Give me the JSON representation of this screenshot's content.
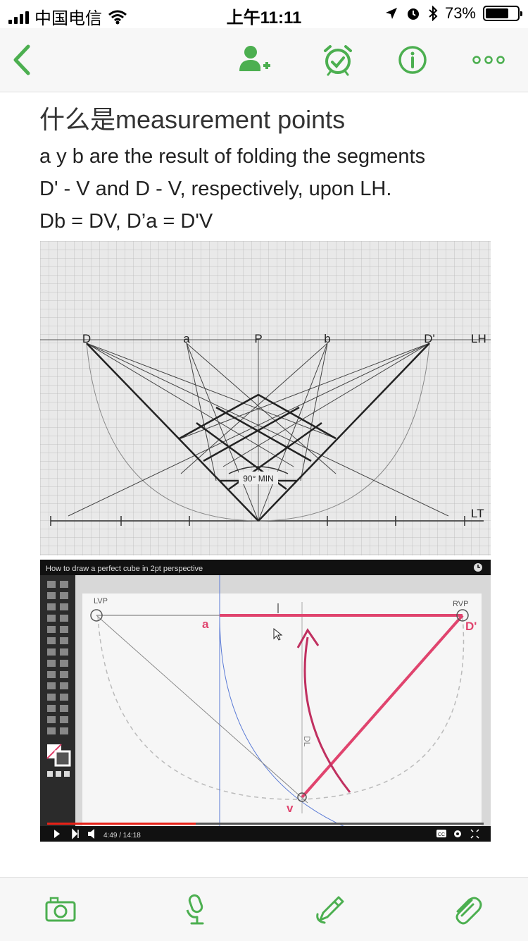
{
  "status_bar": {
    "carrier": "中国电信",
    "time": "上午11:11",
    "battery": "73%",
    "battery_level": 0.73
  },
  "nav": {
    "icons": [
      "back-chevron-icon",
      "add-person-icon",
      "alarm-clock-icon",
      "info-icon",
      "more-dots-icon"
    ]
  },
  "note": {
    "title": "什么是measurement points",
    "lines": [
      "a y b are the result of folding the segments",
      "D' - V and D - V, respectively, upon LH.",
      "Db = DV, D’a = D'V"
    ]
  },
  "figure1": {
    "labels": {
      "d": "D",
      "a": "a",
      "p": "P",
      "b": "b",
      "dprime": "D'",
      "lh": "LH",
      "lt": "LT",
      "angle": "90° MIN"
    }
  },
  "video": {
    "title": "How to draw a perfect cube in 2pt perspective",
    "time": "4:49 / 14:18",
    "progress": 0.34,
    "labels": {
      "lvp": "LVP",
      "rvp": "RVP",
      "a": "a",
      "dprime": "D'",
      "v": "v",
      "dl": "DL"
    },
    "cc_label": "CC"
  },
  "bottom_toolbar": {
    "icons": [
      "camera-icon",
      "microphone-icon",
      "pen-icon",
      "paperclip-icon"
    ]
  },
  "colors": {
    "accent": "#4caf50",
    "video_pink": "#e0446e"
  }
}
